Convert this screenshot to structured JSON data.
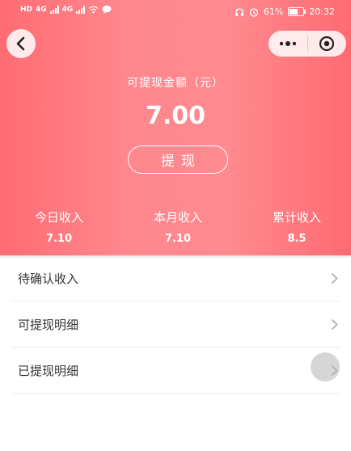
{
  "status_bar": {
    "left_labels": [
      "HD",
      "HD",
      "4G",
      "4G"
    ],
    "battery_percent": "61%",
    "time": "20:32"
  },
  "summary": {
    "withdrawable_label": "可提现金额（元）",
    "withdrawable_amount": "7.00",
    "withdraw_button": "提现"
  },
  "stats": [
    {
      "label": "今日收入",
      "value": "7.10"
    },
    {
      "label": "本月收入",
      "value": "7.10"
    },
    {
      "label": "累计收入",
      "value": "8.5"
    }
  ],
  "menu": [
    {
      "label": "待确认收入"
    },
    {
      "label": "可提现明细"
    },
    {
      "label": "已提现明细"
    }
  ],
  "icons": {
    "back": "chevron-left-icon",
    "more": "more-dots-icon",
    "close": "target-close-icon",
    "row_arrow": "chevron-right-icon"
  },
  "colors": {
    "header_gradient": [
      "#ff6b73",
      "#ff8a8f"
    ],
    "text_on_header": "#ffffff"
  }
}
